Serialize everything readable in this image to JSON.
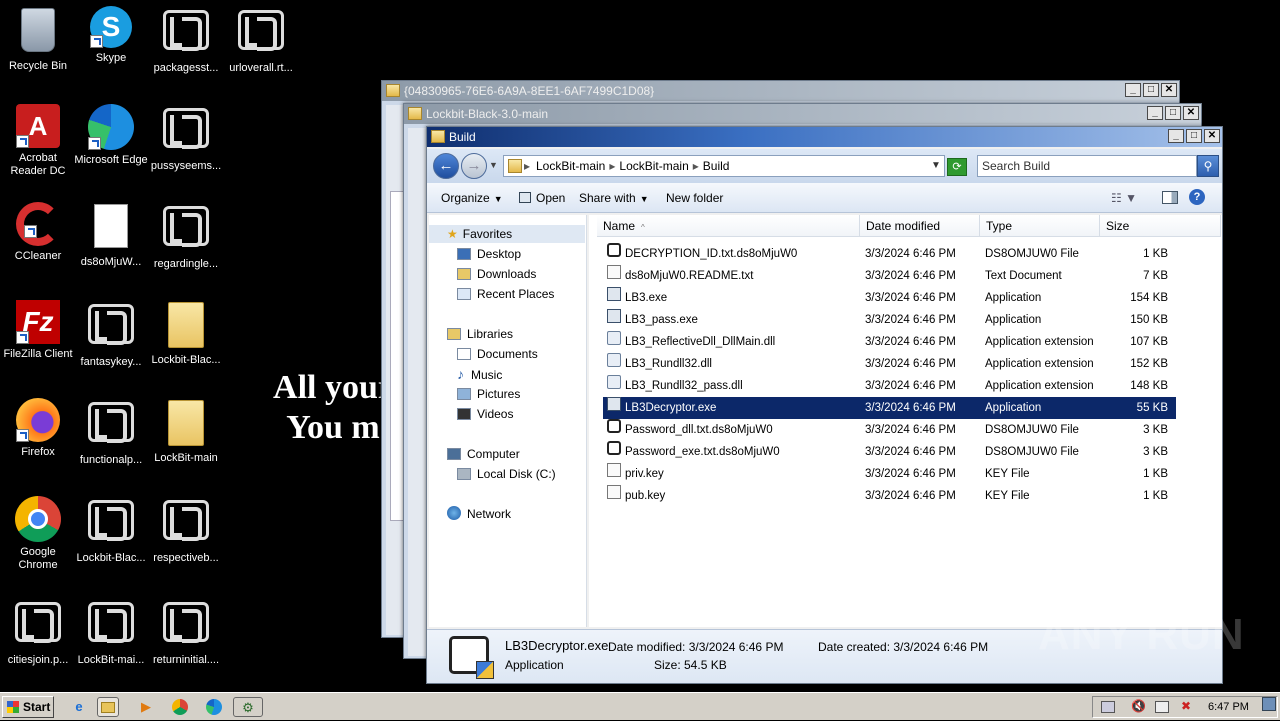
{
  "desktop": {
    "icons": [
      {
        "label": "Recycle Bin"
      },
      {
        "label": "Skype"
      },
      {
        "label": "packagesst..."
      },
      {
        "label": "urloverall.rt..."
      },
      {
        "label": "Acrobat Reader DC"
      },
      {
        "label": "Microsoft Edge"
      },
      {
        "label": "pussyseems..."
      },
      {
        "label": "CCleaner"
      },
      {
        "label": "ds8oMjuW..."
      },
      {
        "label": "regardingle..."
      },
      {
        "label": "FileZilla Client"
      },
      {
        "label": "fantasykey..."
      },
      {
        "label": "Lockbit-Blac..."
      },
      {
        "label": "Firefox"
      },
      {
        "label": "functionalp..."
      },
      {
        "label": "LockBit-main"
      },
      {
        "label": "Google Chrome"
      },
      {
        "label": "Lockbit-Blac..."
      },
      {
        "label": "respectiveb..."
      },
      {
        "label": "citiesjoin.p..."
      },
      {
        "label": "LockBit-mai..."
      },
      {
        "label": "returninitial...."
      }
    ],
    "ransom_line1": "All your",
    "ransom_line2": "You m"
  },
  "windows": {
    "back": {
      "title": "{04830965-76E6-6A9A-8EE1-6AF7499C1D08}"
    },
    "middle": {
      "title": "Lockbit-Black-3.0-main"
    },
    "front": {
      "title": "Build"
    }
  },
  "explorer": {
    "breadcrumb": [
      "LockBit-main",
      "LockBit-main",
      "Build"
    ],
    "search_placeholder": "Search Build",
    "toolbar": {
      "organize": "Organize",
      "open": "Open",
      "share_with": "Share with",
      "new_folder": "New folder"
    },
    "nav": {
      "favorites": "Favorites",
      "desktop": "Desktop",
      "downloads": "Downloads",
      "recent_places": "Recent Places",
      "libraries": "Libraries",
      "documents": "Documents",
      "music": "Music",
      "pictures": "Pictures",
      "videos": "Videos",
      "computer": "Computer",
      "local_disk": "Local Disk (C:)",
      "network": "Network"
    },
    "columns": {
      "name": "Name",
      "date_modified": "Date modified",
      "type": "Type",
      "size": "Size"
    },
    "files": [
      {
        "name": "DECRYPTION_ID.txt.ds8oMjuW0",
        "date": "3/3/2024 6:46 PM",
        "type": "DS8OMJUW0 File",
        "size": "1 KB"
      },
      {
        "name": "ds8oMjuW0.README.txt",
        "date": "3/3/2024 6:46 PM",
        "type": "Text Document",
        "size": "7 KB"
      },
      {
        "name": "LB3.exe",
        "date": "3/3/2024 6:46 PM",
        "type": "Application",
        "size": "154 KB"
      },
      {
        "name": "LB3_pass.exe",
        "date": "3/3/2024 6:46 PM",
        "type": "Application",
        "size": "150 KB"
      },
      {
        "name": "LB3_ReflectiveDll_DllMain.dll",
        "date": "3/3/2024 6:46 PM",
        "type": "Application extension",
        "size": "107 KB"
      },
      {
        "name": "LB3_Rundll32.dll",
        "date": "3/3/2024 6:46 PM",
        "type": "Application extension",
        "size": "152 KB"
      },
      {
        "name": "LB3_Rundll32_pass.dll",
        "date": "3/3/2024 6:46 PM",
        "type": "Application extension",
        "size": "148 KB"
      },
      {
        "name": "LB3Decryptor.exe",
        "date": "3/3/2024 6:46 PM",
        "type": "Application",
        "size": "55 KB"
      },
      {
        "name": "Password_dll.txt.ds8oMjuW0",
        "date": "3/3/2024 6:46 PM",
        "type": "DS8OMJUW0 File",
        "size": "3 KB"
      },
      {
        "name": "Password_exe.txt.ds8oMjuW0",
        "date": "3/3/2024 6:46 PM",
        "type": "DS8OMJUW0 File",
        "size": "3 KB"
      },
      {
        "name": "priv.key",
        "date": "3/3/2024 6:46 PM",
        "type": "KEY File",
        "size": "1 KB"
      },
      {
        "name": "pub.key",
        "date": "3/3/2024 6:46 PM",
        "type": "KEY File",
        "size": "1 KB"
      }
    ],
    "details": {
      "name": "LB3Decryptor.exe",
      "kind": "Application",
      "modified": "Date modified: 3/3/2024 6:46 PM",
      "created": "Date created: 3/3/2024 6:46 PM",
      "size": "Size: 54.5 KB"
    }
  },
  "taskbar": {
    "start": "Start",
    "clock": "6:47 PM"
  },
  "watermark": "ANY RUN",
  "colors": {
    "selection": "#0c2869",
    "active_title": "#1e4a9a"
  }
}
